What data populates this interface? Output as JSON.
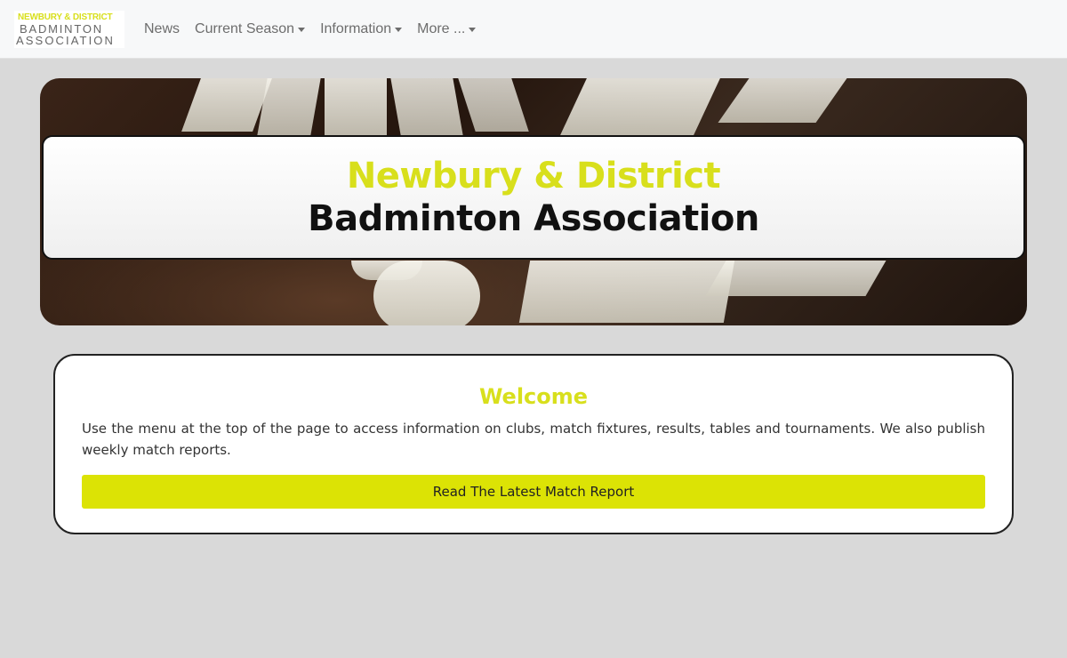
{
  "logo": {
    "line1": "NEWBURY & DISTRICT",
    "line2": "BADMINTON",
    "line3": "ASSOCIATION"
  },
  "nav": {
    "items": [
      {
        "label": "News",
        "dropdown": false
      },
      {
        "label": "Current Season",
        "dropdown": true
      },
      {
        "label": "Information",
        "dropdown": true
      },
      {
        "label": "More ...",
        "dropdown": true
      }
    ]
  },
  "hero": {
    "title_line1": "Newbury & District",
    "title_line2": "Badminton Association"
  },
  "welcome": {
    "title": "Welcome",
    "text": "Use the menu at the top of the page to access information on clubs, match fixtures, results, tables and tournaments. We also publish weekly match reports.",
    "button_label": "Read The Latest Match Report"
  },
  "colors": {
    "accent": "#d8df1c",
    "button": "#dce305",
    "page_background": "#d9d9d9"
  }
}
